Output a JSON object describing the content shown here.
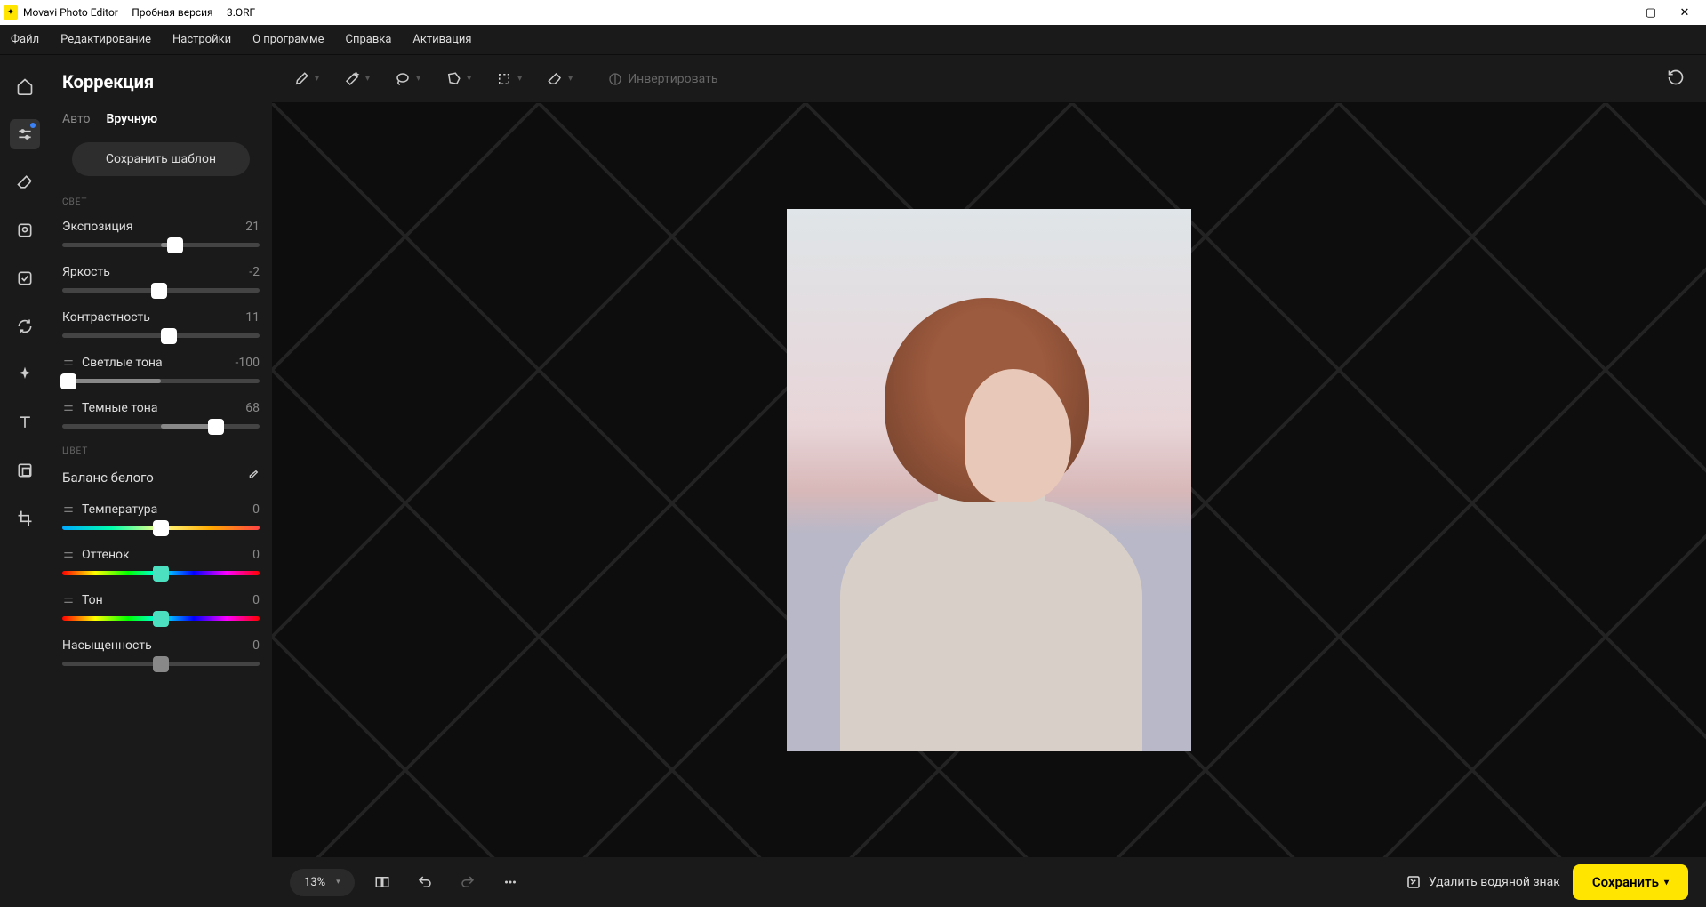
{
  "titlebar": {
    "title": "Movavi Photo Editor — Пробная версия — 3.ORF"
  },
  "menubar": {
    "items": [
      "Файл",
      "Редактирование",
      "Настройки",
      "О программе",
      "Справка",
      "Активация"
    ]
  },
  "leftrail": {
    "tools": [
      "home",
      "adjust",
      "eraser",
      "face",
      "effects",
      "sync",
      "sparkle",
      "text",
      "resize",
      "crop"
    ]
  },
  "panel": {
    "title": "Коррекция",
    "tabs": [
      "Авто",
      "Вручную"
    ],
    "active_tab": 1,
    "save_template": "Сохранить шаблон",
    "sections": {
      "light": {
        "label": "СВЕТ",
        "sliders": [
          {
            "label": "Экспозиция",
            "value": 21,
            "pos": 57,
            "mini": false
          },
          {
            "label": "Яркость",
            "value": -2,
            "pos": 49,
            "mini": false
          },
          {
            "label": "Контрастность",
            "value": 11,
            "pos": 54,
            "mini": false
          },
          {
            "label": "Светлые тона",
            "value": -100,
            "pos": 0,
            "mini": true
          },
          {
            "label": "Темные тона",
            "value": 68,
            "pos": 78,
            "mini": true
          }
        ]
      },
      "color": {
        "label": "ЦВЕТ",
        "wb_label": "Баланс белого",
        "sliders": [
          {
            "label": "Температура",
            "value": 0,
            "pos": 50,
            "mini": true,
            "grad": "temp",
            "thumb": "white"
          },
          {
            "label": "Оттенок",
            "value": 0,
            "pos": 50,
            "mini": true,
            "grad": "tint",
            "thumb": "teal"
          },
          {
            "label": "Тон",
            "value": 0,
            "pos": 50,
            "mini": true,
            "grad": "tone",
            "thumb": "teal"
          },
          {
            "label": "Насыщенность",
            "value": 0,
            "pos": 50,
            "mini": false,
            "thumb": "gray"
          }
        ]
      }
    }
  },
  "toptools": {
    "tools": [
      "brush",
      "wand",
      "lasso",
      "poly-lasso",
      "marquee",
      "eraser-sel"
    ],
    "invert": "Инвертировать"
  },
  "bottom": {
    "zoom": "13%",
    "remove_wm": "Удалить водяной знак",
    "save": "Сохранить"
  }
}
